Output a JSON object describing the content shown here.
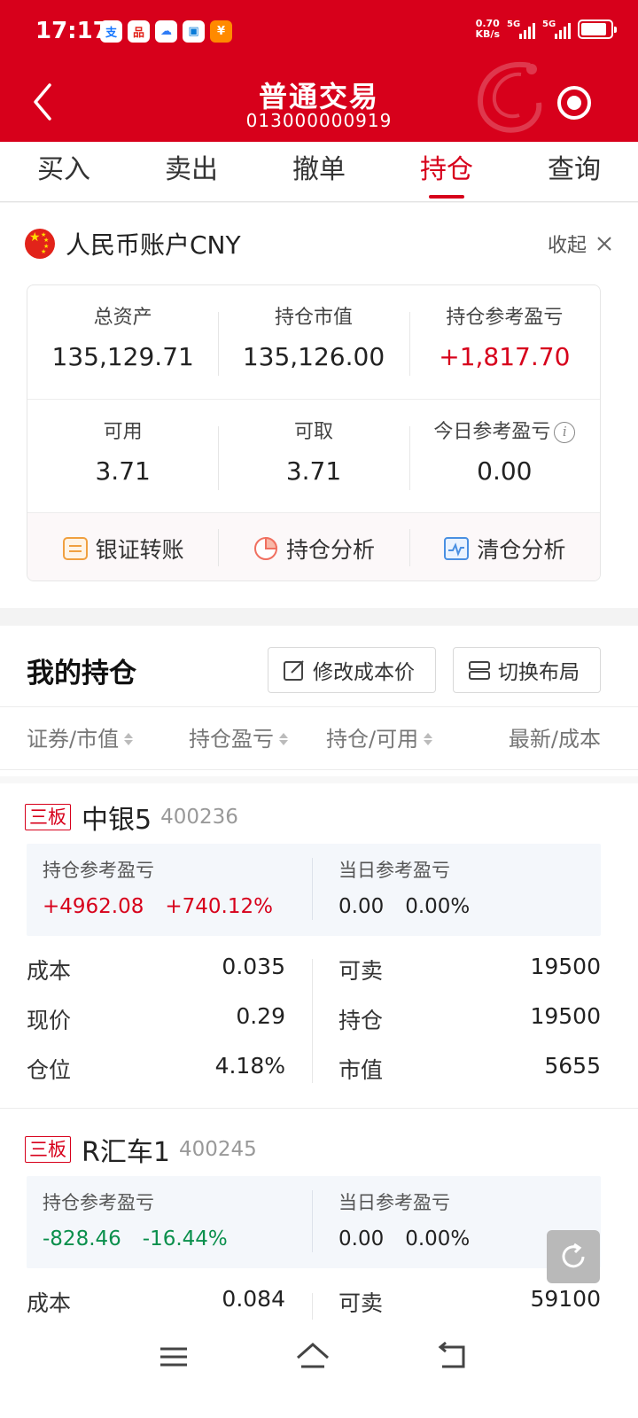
{
  "status_bar": {
    "time": "17:17",
    "net_speed_value": "0.70",
    "net_speed_unit": "KB/s",
    "signal1_label": "5G",
    "signal2_label": "5G"
  },
  "header": {
    "title": "普通交易",
    "account_no": "013000000919"
  },
  "tabs": [
    {
      "label": "买入"
    },
    {
      "label": "卖出"
    },
    {
      "label": "撤单"
    },
    {
      "label": "持仓"
    },
    {
      "label": "查询"
    }
  ],
  "account": {
    "title": "人民币账户CNY",
    "collapse_label": "收起",
    "total_assets_label": "总资产",
    "total_assets": "135,129.71",
    "market_value_label": "持仓市值",
    "market_value": "135,126.00",
    "position_pl_label": "持仓参考盈亏",
    "position_pl": "+1,817.70",
    "available_label": "可用",
    "available": "3.71",
    "withdrawable_label": "可取",
    "withdrawable": "3.71",
    "today_pl_label": "今日参考盈亏",
    "today_pl": "0.00",
    "actions": [
      {
        "label": "银证转账"
      },
      {
        "label": "持仓分析"
      },
      {
        "label": "清仓分析"
      }
    ]
  },
  "holdings": {
    "title": "我的持仓",
    "edit_cost_label": "修改成本价",
    "switch_layout_label": "切换布局",
    "columns": [
      "证券/市值",
      "持仓盈亏",
      "持仓/可用",
      "最新/成本"
    ],
    "stocks": [
      {
        "tag": "三板",
        "name": "中银5",
        "code": "400236",
        "pl_label": "持仓参考盈亏",
        "pl_amount": "+4962.08",
        "pl_pct": "+740.12%",
        "day_label": "当日参考盈亏",
        "day_amount": "0.00",
        "day_pct": "0.00%",
        "cost_label": "成本",
        "cost": "0.035",
        "sellable_label": "可卖",
        "sellable": "19500",
        "price_label": "现价",
        "price": "0.29",
        "position_label": "持仓",
        "position": "19500",
        "weight_label": "仓位",
        "weight": "4.18%",
        "mv_label": "市值",
        "mv": "5655"
      },
      {
        "tag": "三板",
        "name": "R汇车1",
        "code": "400245",
        "pl_label": "持仓参考盈亏",
        "pl_amount": "-828.46",
        "pl_pct": "-16.44%",
        "day_label": "当日参考盈亏",
        "day_amount": "0.00",
        "day_pct": "0.00%",
        "cost_label": "成本",
        "cost": "0.084",
        "sellable_label": "可卖",
        "sellable": "59100"
      }
    ]
  },
  "colors": {
    "brand_red": "#d7001b",
    "gain": "#d7001b",
    "loss": "#0a8f4c"
  },
  "icons": [
    "back-icon",
    "record-icon",
    "flag-cn-icon",
    "close-icon",
    "info-icon",
    "transfer-icon",
    "pie-chart-icon",
    "line-chart-icon",
    "edit-icon",
    "layout-icon",
    "sort-icon",
    "refresh-icon",
    "menu-icon",
    "home-icon",
    "return-icon"
  ]
}
